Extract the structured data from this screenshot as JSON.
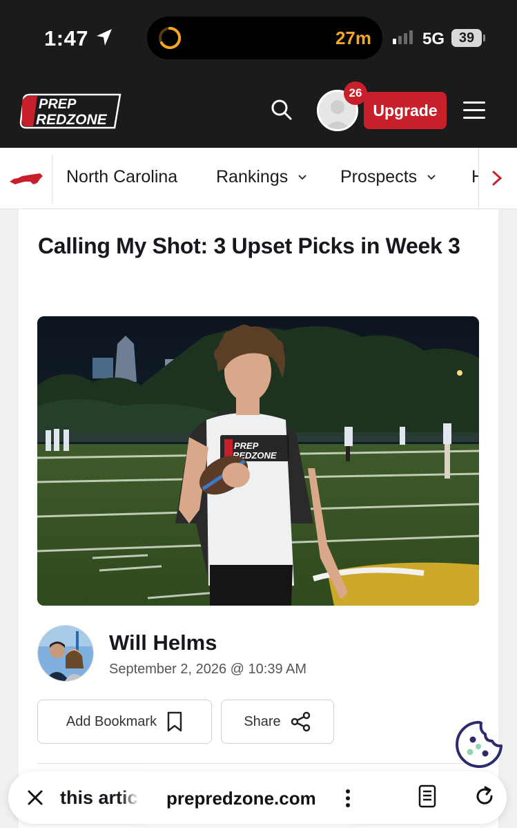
{
  "status_bar": {
    "time": "1:47",
    "timer": "27m",
    "network": "5G",
    "battery": "39"
  },
  "header": {
    "logo_line1": "PREP",
    "logo_line2": "REDZONE",
    "notification_count": "26",
    "upgrade_label": "Upgrade"
  },
  "nav": {
    "items": [
      {
        "label": "North Carolina"
      },
      {
        "label": "Rankings"
      },
      {
        "label": "Prospects"
      },
      {
        "label": "H"
      }
    ]
  },
  "article": {
    "title": "Calling My Shot: 3 Upset Picks in Week 3",
    "author": "Will Helms",
    "date": "September 2, 2026 @ 10:39 AM",
    "bookmark_label": "Add Bookmark",
    "share_label": "Share",
    "shirt_line1": "PREP",
    "shirt_line2": "REDZONE"
  },
  "browser": {
    "peek_text": "this artic",
    "url": "prepredzone.com"
  },
  "colors": {
    "brand_red": "#c8202b",
    "header_dark": "#1b1b1d",
    "timer_orange": "#f5a623",
    "cookie_navy": "#2d2b6b"
  }
}
